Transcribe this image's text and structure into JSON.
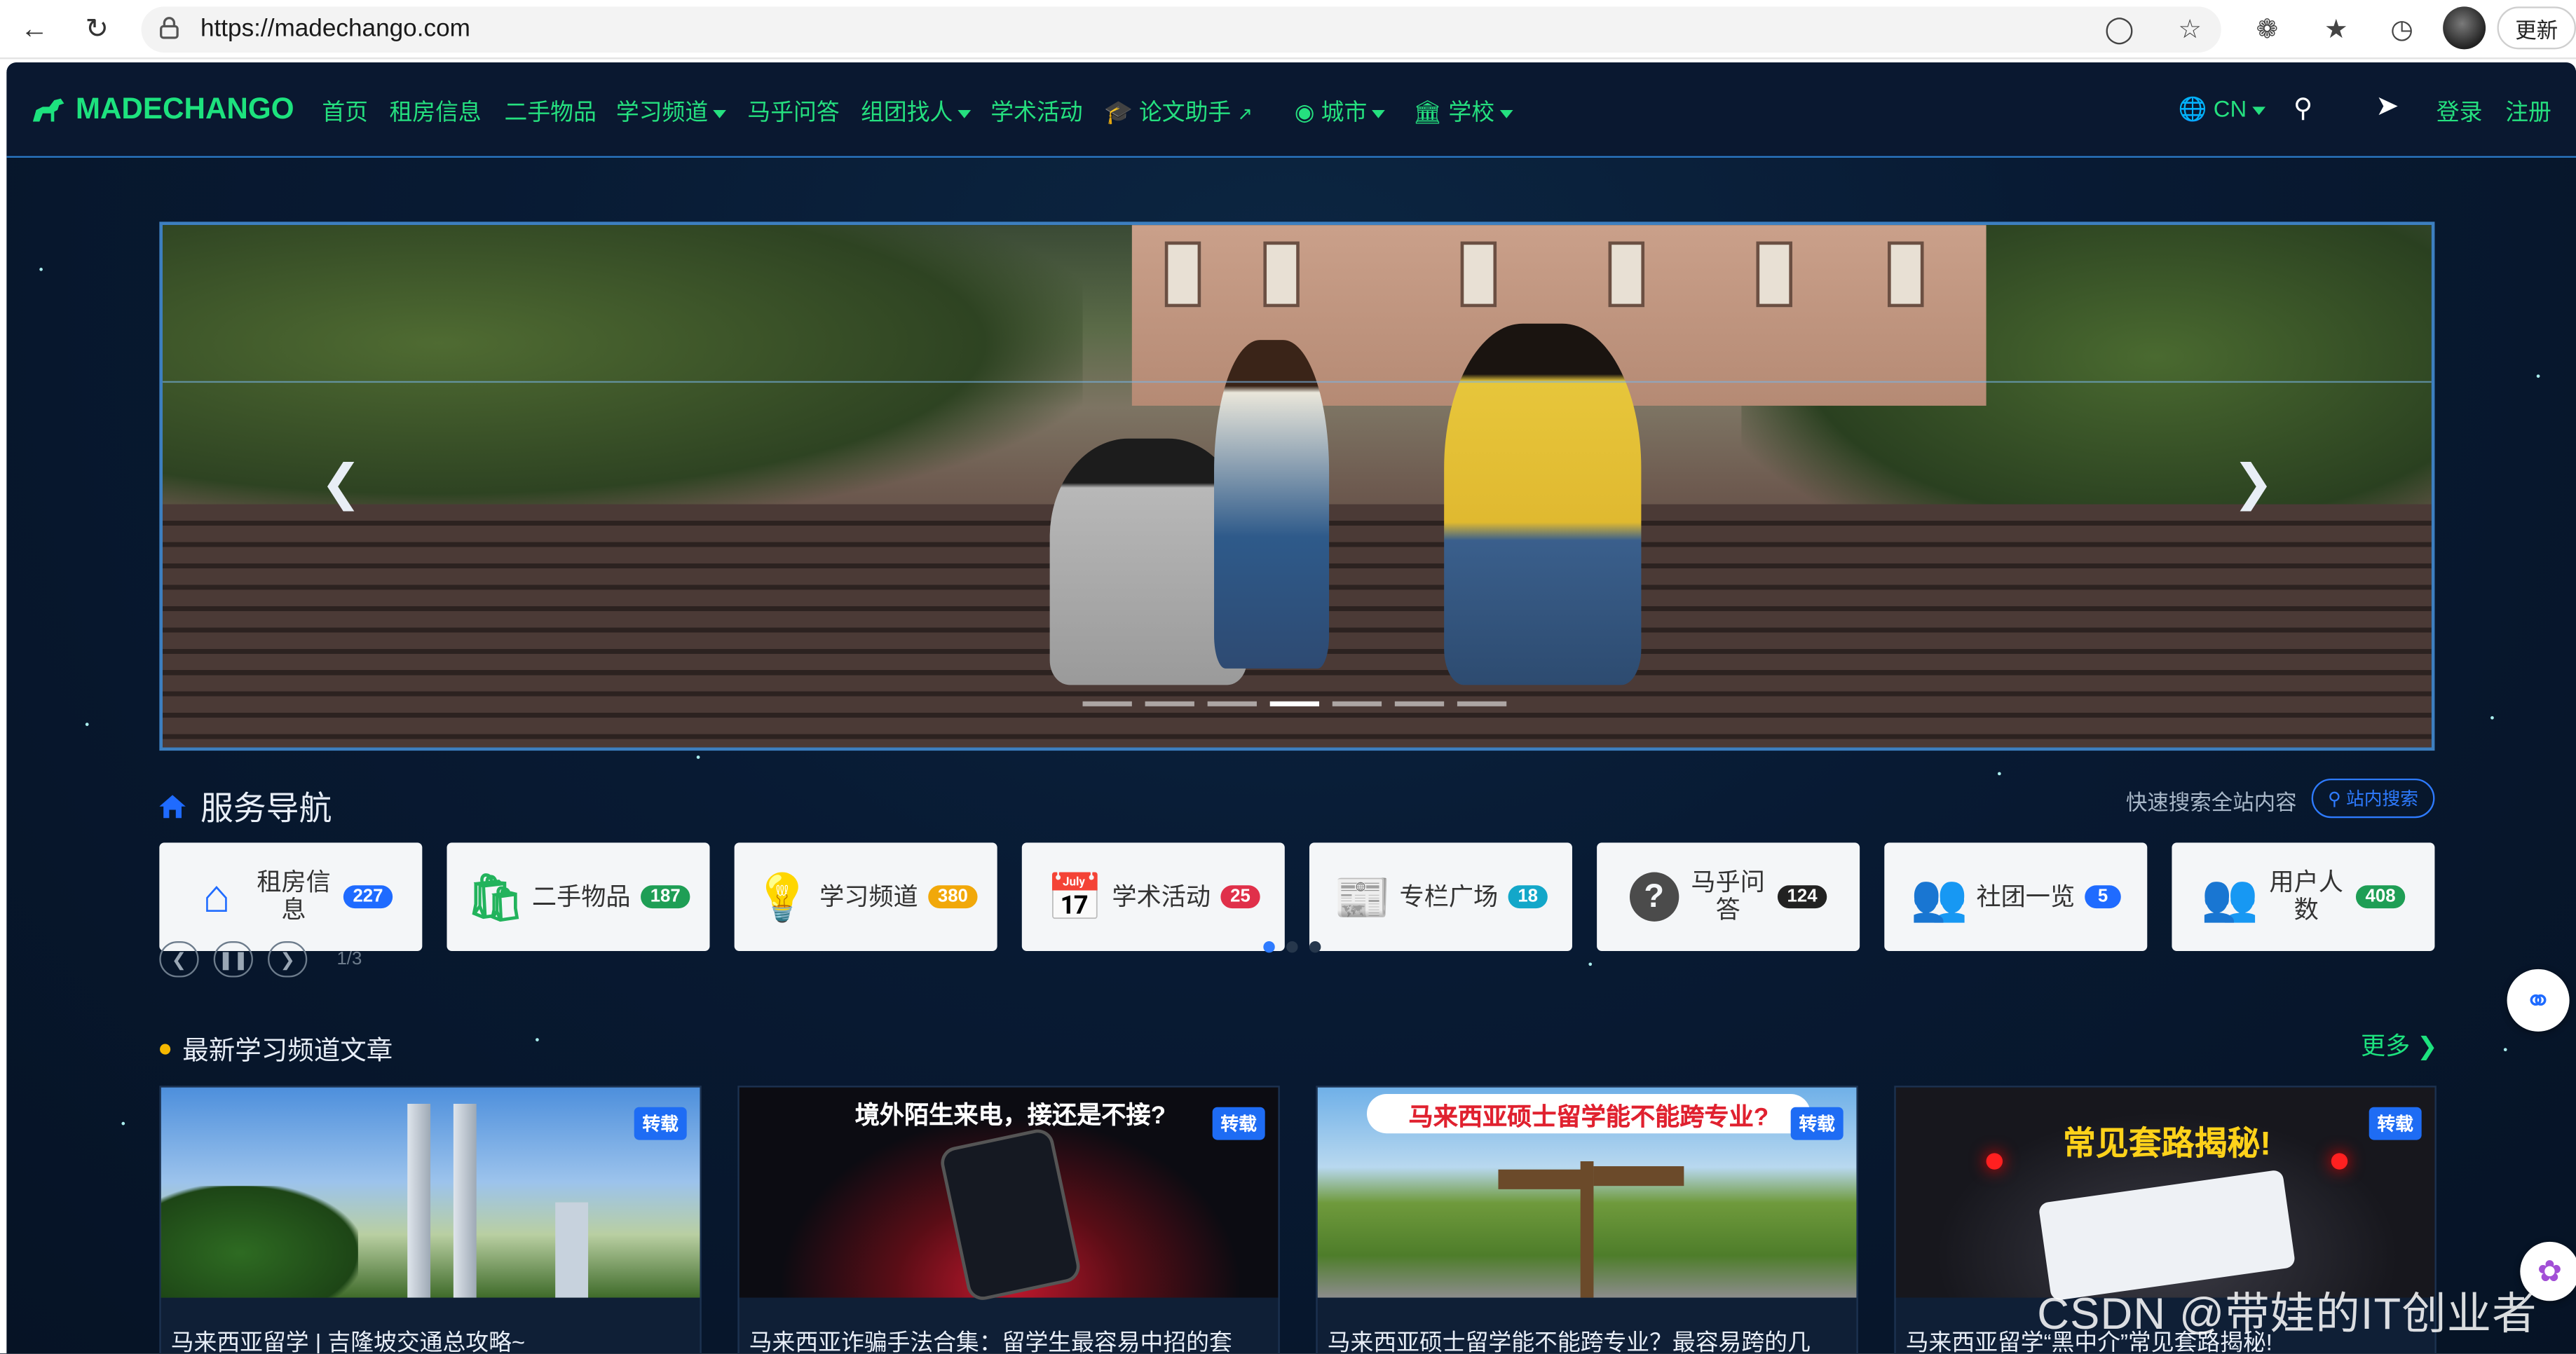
{
  "browser": {
    "url": "https://madechango.com",
    "update_label": "更新"
  },
  "nav": {
    "brand": "MADECHANGO",
    "items": [
      "首页",
      "租房信息",
      "二手物品",
      "学习频道",
      "马乎问答",
      "组团找人",
      "学术活动",
      "论文助手",
      "城市",
      "学校"
    ],
    "lang": "CN",
    "login": "登录",
    "register": "注册"
  },
  "banner": {
    "slides": 7,
    "active": 3
  },
  "services": {
    "title": "服务导航",
    "hint": "快速搜索全站内容",
    "search_label": "站内搜索",
    "cards": [
      {
        "label": "租房信息",
        "count": "227",
        "icon": "home-icon",
        "badge": "#1f6bff",
        "icon_color": "#1f6bff"
      },
      {
        "label": "二手物品",
        "count": "187",
        "icon": "shopping-bag-icon",
        "badge": "#1e9e55",
        "icon_color": "#22b35c"
      },
      {
        "label": "学习频道",
        "count": "380",
        "icon": "lightbulb-icon",
        "badge": "#f1a80a",
        "icon_color": "#f5b800"
      },
      {
        "label": "学术活动",
        "count": "25",
        "icon": "calendar-icon",
        "badge": "#e0304a",
        "icon_color": "#e0304a"
      },
      {
        "label": "专栏广场",
        "count": "18",
        "icon": "newspaper-icon",
        "badge": "#13a7c9",
        "icon_color": "#1597c8"
      },
      {
        "label": "马乎问答",
        "count": "124",
        "icon": "question-icon",
        "badge": "#222222",
        "icon_color": "#4b4b4b"
      },
      {
        "label": "社团一览",
        "count": "5",
        "icon": "users-icon",
        "badge": "#1f6bff",
        "icon_color": "#1f6bff"
      },
      {
        "label": "用户人数",
        "count": "408",
        "icon": "user-group-icon",
        "badge": "#1e9e55",
        "icon_color": "#22b35c"
      }
    ],
    "page_indicator": "1/3"
  },
  "articles": {
    "title": "最新学习频道文章",
    "more": "更多",
    "tag": "转载",
    "items": [
      {
        "title": "马来西亚留学 | 吉隆坡交通总攻略~",
        "caption": ""
      },
      {
        "title": "马来西亚诈骗手法合集：留学生最容易中招的套",
        "caption": "境外陌生来电，接还是不接?"
      },
      {
        "title": "马来西亚硕士留学能不能跨专业？最容易跨的几",
        "caption": "马来西亚硕士留学能不能跨专业?"
      },
      {
        "title": "马来西亚留学“黑中介”常见套路揭秘!",
        "caption": "常见套路揭秘!"
      }
    ]
  },
  "watermark": "CSDN @带娃的IT创业者"
}
